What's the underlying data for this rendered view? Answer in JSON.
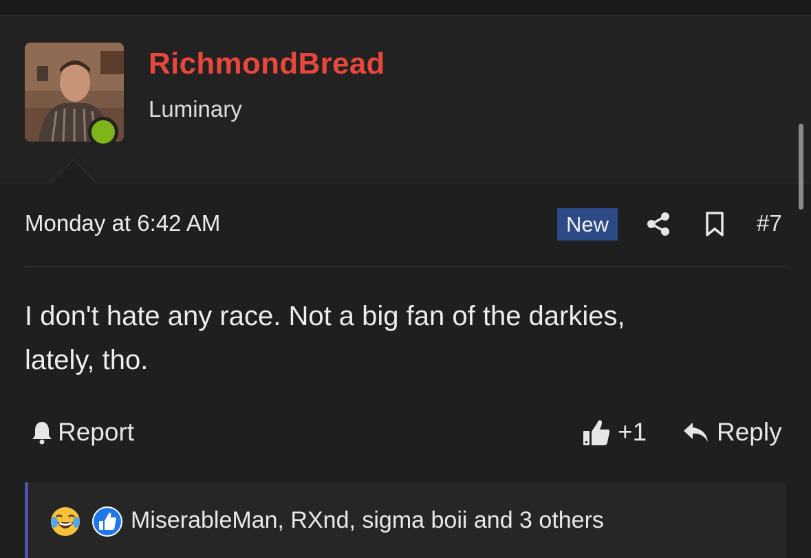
{
  "user": {
    "name": "RichmondBread",
    "title": "Luminary",
    "online": true,
    "colors": {
      "name": "#e8473b",
      "online": "#7fb51a"
    }
  },
  "post": {
    "date": "Monday at 6:42 AM",
    "badge": "New",
    "number": "#7",
    "body_line1": "I don't hate any race. Not a big fan of the darkies,",
    "body_line2": "lately, tho."
  },
  "actions": {
    "report_label": "Report",
    "like_label": "+1",
    "reply_label": "Reply"
  },
  "reactions": {
    "icons": [
      "laughing-crying-emoji-icon",
      "thumbs-up-reaction-icon"
    ],
    "summary": "MiserableMan, RXnd, sigma boii and 3 others"
  },
  "icons": {
    "share": "share-icon",
    "bookmark": "bookmark-icon",
    "report": "bell-icon",
    "like": "thumbs-up-icon",
    "reply": "reply-arrow-icon"
  }
}
